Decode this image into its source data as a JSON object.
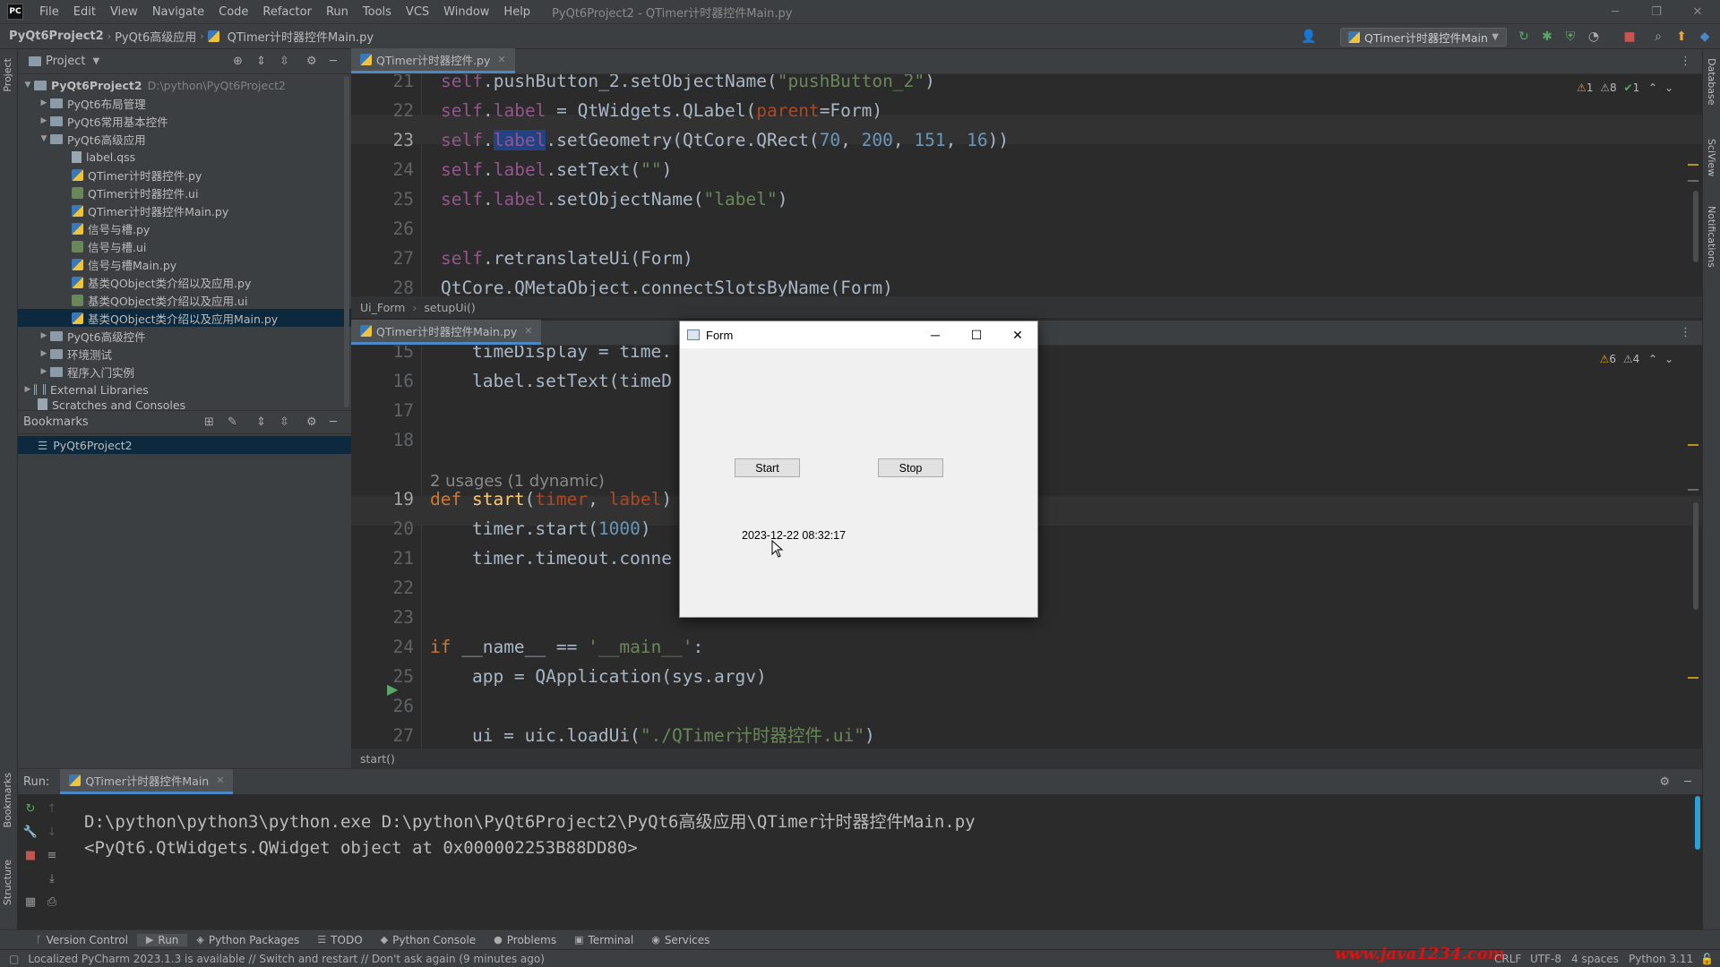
{
  "menubar": {
    "logo": "PC",
    "items": [
      "File",
      "Edit",
      "View",
      "Navigate",
      "Code",
      "Refactor",
      "Run",
      "Tools",
      "VCS",
      "Window",
      "Help"
    ],
    "window_title": "PyQt6Project2 - QTimer计时器控件Main.py"
  },
  "navbar": {
    "crumbs": [
      "PyQt6Project2",
      "PyQt6高级应用",
      "QTimer计时器控件Main.py"
    ],
    "run_config": "QTimer计时器控件Main"
  },
  "left_strip": {
    "project": "Project",
    "bookmarks": "Bookmarks",
    "structure": "Structure"
  },
  "right_strip": {
    "database": "Database",
    "sciview": "SciView",
    "notifications": "Notifications"
  },
  "project_panel": {
    "title": "Project",
    "root": {
      "name": "PyQt6Project2",
      "path": "D:\\python\\PyQt6Project2"
    },
    "items": [
      {
        "label": "PyQt6布局管理"
      },
      {
        "label": "PyQt6常用基本控件"
      },
      {
        "label": "PyQt6高级应用"
      },
      {
        "label": "label.qss"
      },
      {
        "label": "QTimer计时器控件.py"
      },
      {
        "label": "QTimer计时器控件.ui"
      },
      {
        "label": "QTimer计时器控件Main.py"
      },
      {
        "label": "信号与槽.py"
      },
      {
        "label": "信号与槽.ui"
      },
      {
        "label": "信号与槽Main.py"
      },
      {
        "label": "基类QObject类介绍以及应用.py"
      },
      {
        "label": "基类QObject类介绍以及应用.ui"
      },
      {
        "label": "基类QObject类介绍以及应用Main.py"
      },
      {
        "label": "PyQt6高级控件"
      },
      {
        "label": "环境测试"
      },
      {
        "label": "程序入门实例"
      },
      {
        "label": "External Libraries"
      },
      {
        "label": "Scratches and Consoles"
      }
    ]
  },
  "bookmarks_panel": {
    "title": "Bookmarks",
    "item": "PyQt6Project2"
  },
  "editor1": {
    "tab": "QTimer计时器控件.py",
    "inspections": {
      "warn1": "1",
      "warn2": "8",
      "ok": "1"
    },
    "lines": [
      {
        "n": "21",
        "tokens": [
          [
            "self",
            "self"
          ],
          [
            ".pushButton_2.setObjectName(",
            ""
          ],
          [
            "\"pushButton_2\"",
            "str"
          ],
          [
            ")",
            ""
          ]
        ]
      },
      {
        "n": "22",
        "tokens": [
          [
            "self",
            "self"
          ],
          [
            ".",
            ""
          ],
          [
            "label",
            "self"
          ],
          [
            " = QtWidgets.QLabel(",
            ""
          ],
          [
            "parent",
            "param"
          ],
          [
            "=Form)",
            ""
          ]
        ]
      },
      {
        "n": "23",
        "tokens": [
          [
            "self",
            "self"
          ],
          [
            ".",
            ""
          ],
          [
            "label",
            "self"
          ],
          [
            ".setGeometry(QtCore.QRect(",
            ""
          ],
          [
            "70",
            "num"
          ],
          [
            ", ",
            ""
          ],
          [
            "200",
            "num"
          ],
          [
            ", ",
            ""
          ],
          [
            "151",
            "num"
          ],
          [
            ", ",
            ""
          ],
          [
            "16",
            "num"
          ],
          [
            "))",
            ""
          ]
        ]
      },
      {
        "n": "24",
        "tokens": [
          [
            "self",
            "self"
          ],
          [
            ".",
            ""
          ],
          [
            "label",
            "self"
          ],
          [
            ".setText(",
            ""
          ],
          [
            "\"\"",
            "str"
          ],
          [
            ")",
            ""
          ]
        ]
      },
      {
        "n": "25",
        "tokens": [
          [
            "self",
            "self"
          ],
          [
            ".",
            ""
          ],
          [
            "label",
            "self"
          ],
          [
            ".setObjectName(",
            ""
          ],
          [
            "\"label\"",
            "str"
          ],
          [
            ")",
            ""
          ]
        ]
      },
      {
        "n": "26",
        "tokens": []
      },
      {
        "n": "27",
        "tokens": [
          [
            "self",
            "self"
          ],
          [
            ".retranslateUi(Form)",
            ""
          ]
        ]
      },
      {
        "n": "28",
        "tokens": [
          [
            "QtCore.QMetaObject.connectSlotsByName(Form)",
            ""
          ]
        ]
      }
    ]
  },
  "editor1_crumbs": [
    "Ui_Form",
    "setupUi()"
  ],
  "editor2": {
    "tab": "QTimer计时器控件Main.py",
    "inspections": {
      "warn1": "6",
      "warn2": "4"
    },
    "usages": "2 usages (1 dynamic)",
    "lines": [
      {
        "n": "15",
        "tokens": [
          [
            "    timeDisplay = time.",
            ""
          ]
        ]
      },
      {
        "n": "16",
        "tokens": [
          [
            "    label.setText(timeD",
            ""
          ]
        ]
      },
      {
        "n": "17",
        "tokens": []
      },
      {
        "n": "18",
        "tokens": []
      },
      {
        "n": "19",
        "tokens": [
          [
            "def ",
            "kw"
          ],
          [
            "start",
            "fn"
          ],
          [
            "(",
            ""
          ],
          [
            "timer",
            "param"
          ],
          [
            ", ",
            ""
          ],
          [
            "label",
            "param"
          ],
          [
            ")",
            ""
          ]
        ]
      },
      {
        "n": "20",
        "tokens": [
          [
            "    timer.start(",
            ""
          ],
          [
            "1000",
            "num"
          ],
          [
            ")",
            ""
          ]
        ]
      },
      {
        "n": "21",
        "tokens": [
          [
            "    timer.timeout.conne",
            ""
          ]
        ]
      },
      {
        "n": "22",
        "tokens": []
      },
      {
        "n": "23",
        "tokens": []
      },
      {
        "n": "24",
        "tokens": [
          [
            "if ",
            "kw"
          ],
          [
            "__name__ == ",
            ""
          ],
          [
            "'__main__'",
            "str"
          ],
          [
            ":",
            ""
          ]
        ]
      },
      {
        "n": "25",
        "tokens": [
          [
            "    app = QApplication(sys.argv)",
            ""
          ]
        ]
      },
      {
        "n": "26",
        "tokens": []
      },
      {
        "n": "27",
        "tokens": [
          [
            "    ui = uic.loadUi(",
            ""
          ],
          [
            "\"./QTimer计时器控件.ui\"",
            "str"
          ],
          [
            ")",
            ""
          ]
        ]
      }
    ],
    "structure": "start()"
  },
  "run_panel": {
    "label": "Run:",
    "tab": "QTimer计时器控件Main",
    "output": [
      "D:\\python\\python3\\python.exe D:\\python\\PyQt6Project2\\PyQt6高级应用\\QTimer计时器控件Main.py",
      "<PyQt6.QtWidgets.QWidget object at 0x000002253B88DD80>"
    ]
  },
  "form_window": {
    "title": "Form",
    "start_label": "Start",
    "stop_label": "Stop",
    "time_text": "2023-12-22 08:32:17"
  },
  "bottom_tabs": [
    "Version Control",
    "Run",
    "Python Packages",
    "TODO",
    "Python Console",
    "Problems",
    "Terminal",
    "Services"
  ],
  "statusbar": {
    "message": "Localized PyCharm 2023.1.3 is available // Switch and restart // Don't ask again (9 minutes ago)",
    "line_sep": "CRLF",
    "encoding": "UTF-8",
    "indent": "4 spaces",
    "interpreter": "Python 3.11",
    "watermark": "www.java1234.com"
  },
  "colors": {
    "accent": "#4a88c7",
    "selection": "#0d293e",
    "keyword": "#cc7832",
    "string": "#6a8759",
    "number": "#6897bb",
    "self": "#94558d"
  }
}
